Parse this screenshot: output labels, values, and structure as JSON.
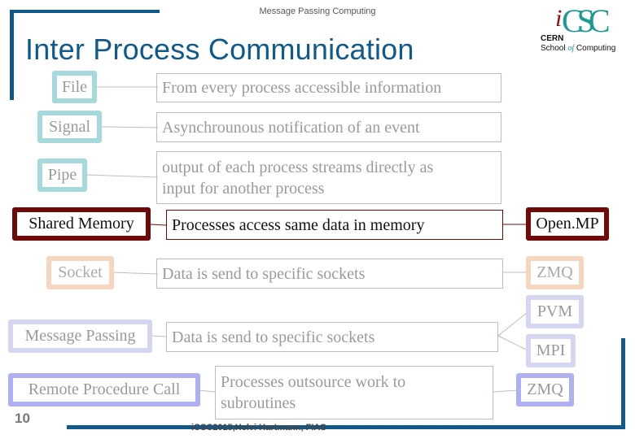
{
  "header": {
    "subtitle": "Message Passing Computing"
  },
  "title": "Inter Process Communication",
  "logo": {
    "i": "i",
    "csc": "CSC",
    "cern": "CERN",
    "school": "School",
    "of": "of",
    "computing": "Computing"
  },
  "rows": [
    {
      "name": "File",
      "description": "From every process accessible information",
      "implementations": []
    },
    {
      "name": "Signal",
      "description": "Asynchrounous notification of an event",
      "implementations": []
    },
    {
      "name": "Pipe",
      "description_line1": "output of each process streams directly as",
      "description_line2": "input for another process",
      "implementations": []
    },
    {
      "name": "Shared Memory",
      "description": "Processes access same data in memory",
      "implementations": [
        "Open.MP"
      ]
    },
    {
      "name": "Socket",
      "description": "Data is send to specific sockets",
      "implementations": [
        "ZMQ"
      ]
    },
    {
      "name": "Message Passing",
      "description": "Data is send to specific sockets",
      "implementations": [
        "PVM",
        "MPI"
      ]
    },
    {
      "name": "Remote Procedure Call",
      "description_line1": "Processes outsource work to",
      "description_line2": "subroutines",
      "implementations": [
        "ZMQ"
      ]
    }
  ],
  "colors": {
    "frame": "#0f5a8a",
    "teal": "#a6d9db",
    "dark_red": "#6e0a0a",
    "peach": "#f7d6bf",
    "lavender": "#d4d6f2",
    "blue": "#aeb0f2"
  },
  "footer": {
    "page_number": "10",
    "credit": "iCSC2015,Helvi Hartmann, FIAS"
  }
}
